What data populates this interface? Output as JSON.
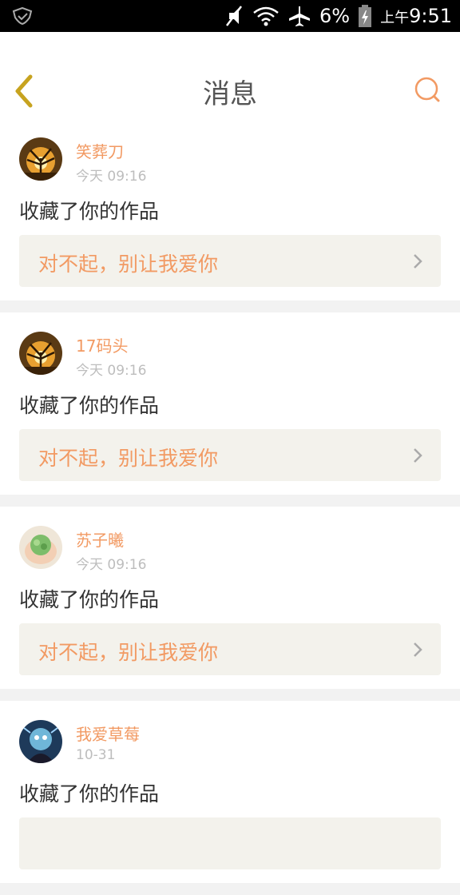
{
  "status_bar": {
    "battery_percent": "6%",
    "time_ampm": "上午",
    "time": "9:51",
    "icons": [
      "shield-notification-icon",
      "mute-icon",
      "wifi-icon",
      "airplane-icon",
      "battery-charging-icon"
    ]
  },
  "header": {
    "title": "消息",
    "back_icon": "chevron-left-icon",
    "search_icon": "search-icon"
  },
  "messages": [
    {
      "username": "笑葬刀",
      "time": "今天 09:16",
      "action": "收藏了你的作品",
      "work_title": "对不起，别让我爱你"
    },
    {
      "username": "17码头",
      "time": "今天 09:16",
      "action": "收藏了你的作品",
      "work_title": "对不起，别让我爱你"
    },
    {
      "username": "苏子曦",
      "time": "今天 09:16",
      "action": "收藏了你的作品",
      "work_title": "对不起，别让我爱你"
    },
    {
      "username": "我爱草莓",
      "time": "10-31",
      "action": "收藏了你的作品",
      "work_title": ""
    }
  ],
  "colors": {
    "accent": "#f29a63",
    "back_icon": "#c7a31f",
    "background": "#f2f2f2",
    "work_box": "#f3f2ec"
  }
}
